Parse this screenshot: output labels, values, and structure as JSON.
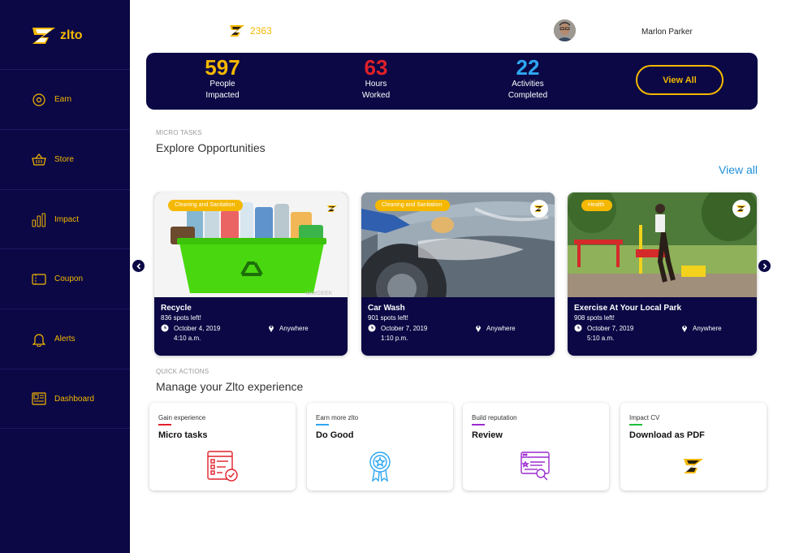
{
  "sidebar": {
    "brand": "zlto",
    "items": [
      {
        "label": "Earn",
        "icon": "earn-icon"
      },
      {
        "label": "Store",
        "icon": "basket-icon"
      },
      {
        "label": "Impact",
        "icon": "bar-chart-icon"
      },
      {
        "label": "Coupon",
        "icon": "coupon-icon"
      },
      {
        "label": "Alerts",
        "icon": "bell-icon"
      },
      {
        "label": "Dashboard",
        "icon": "dashboard-icon"
      }
    ]
  },
  "header": {
    "zlto_balance": "2363",
    "user_name": "Marlon Parker"
  },
  "stats": {
    "items": [
      {
        "value": "597",
        "label_line1": "People",
        "label_line2": "Impacted",
        "color": "#f5b800"
      },
      {
        "value": "63",
        "label_line1": "Hours",
        "label_line2": "Worked",
        "color": "#e0202a"
      },
      {
        "value": "22",
        "label_line1": "Activities",
        "label_line2": "Completed",
        "color": "#2ea6f0"
      }
    ],
    "view_all": "View All"
  },
  "micro_tasks": {
    "kicker": "MICRO TASKS",
    "title": "Explore Opportunities",
    "view_all": "View all",
    "cards": [
      {
        "badge": "Cleaning and Sanitation",
        "title": "Recycle",
        "spots": "836 spots left!",
        "date": "October 4, 2019",
        "time": "4:10 a.m.",
        "location": "Anywhere"
      },
      {
        "badge": "Cleaning and Sanitation",
        "title": "Car Wash",
        "spots": "901 spots left!",
        "date": "October 7, 2019",
        "time": "1:10 p.m.",
        "location": "Anywhere"
      },
      {
        "badge": "Health",
        "title": "Exercise At Your Local Park",
        "spots": "908 spots left!",
        "date": "October 7, 2019",
        "time": "5:10 a.m.",
        "location": "Anywhere"
      }
    ]
  },
  "quick_actions": {
    "kicker": "QUICK ACTIONS",
    "title": "Manage your Zlto experience",
    "items": [
      {
        "kicker": "Gain experience",
        "title": "Micro tasks",
        "accent": "#e0202a",
        "icon": "checklist-icon"
      },
      {
        "kicker": "Earn more zlto",
        "title": "Do Good",
        "accent": "#2ea6f0",
        "icon": "award-badge-icon"
      },
      {
        "kicker": "Build reputation",
        "title": "Review",
        "accent": "#9b2bd0",
        "icon": "review-icon"
      },
      {
        "kicker": "Impact CV",
        "title": "Download as PDF",
        "accent": "#1fbf3a",
        "icon": "zlto-logo-icon"
      }
    ]
  }
}
